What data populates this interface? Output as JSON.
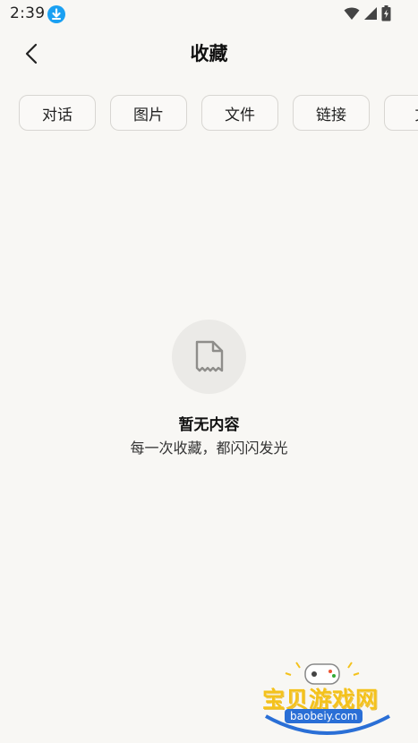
{
  "status_bar": {
    "time": "2:39",
    "icons": [
      "download-icon",
      "wifi-icon",
      "signal-icon",
      "battery-icon"
    ]
  },
  "header": {
    "title": "收藏",
    "back_icon": "chevron-left-icon"
  },
  "tabs": [
    {
      "label": "对话"
    },
    {
      "label": "图片"
    },
    {
      "label": "文件"
    },
    {
      "label": "链接"
    },
    {
      "label": "文"
    }
  ],
  "empty_state": {
    "icon": "document-icon",
    "title": "暂无内容",
    "subtitle": "每一次收藏，都闪闪发光"
  },
  "watermark": {
    "text": "宝贝游戏网",
    "url": "baobeiy.com"
  },
  "colors": {
    "background": "#f8f7f4",
    "tab_border": "#d8d6d2",
    "download_badge": "#1aa0f2",
    "empty_icon_bg": "#ebeae7"
  }
}
